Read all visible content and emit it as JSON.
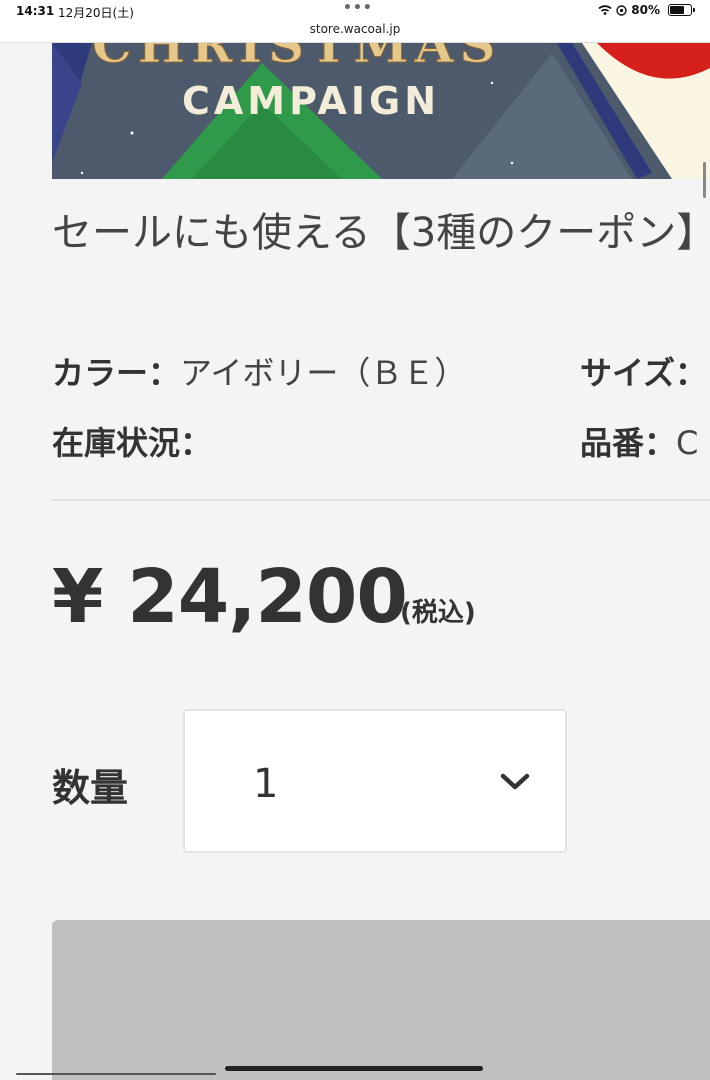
{
  "status_bar": {
    "time": "14:31",
    "date": "12月20日(土)",
    "battery": "80%",
    "battery_level": 0.8
  },
  "browser": {
    "url": "store.wacoal.jp"
  },
  "banner": {
    "text": "CAMPAIGN",
    "partial_text": "CHRISTMAS"
  },
  "product": {
    "title": "セールにも使える【3種のクーポン】",
    "color_label": "カラー：",
    "color_value": "アイボリー（ＢＥ）",
    "size_label": "サイズ：",
    "stock_label": "在庫状況：",
    "item_number_label": "品番：",
    "item_number_value": "C"
  },
  "price": {
    "amount": "¥ 24,200",
    "tax_note": "(税込)"
  },
  "quantity": {
    "label": "数量",
    "selected": "1"
  },
  "colors": {
    "background": "#f4f4f4",
    "text": "#333333",
    "cart_placeholder": "#c0c0c0"
  }
}
